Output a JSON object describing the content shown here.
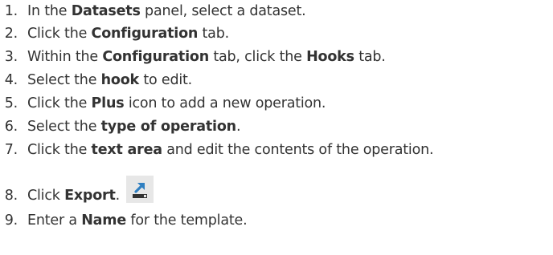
{
  "steps": [
    {
      "num": "1.",
      "parts": [
        {
          "text": "In the ",
          "bold": false
        },
        {
          "text": "Datasets",
          "bold": true
        },
        {
          "text": " panel, select a dataset.",
          "bold": false
        }
      ]
    },
    {
      "num": "2.",
      "parts": [
        {
          "text": "Click the ",
          "bold": false
        },
        {
          "text": "Configuration",
          "bold": true
        },
        {
          "text": " tab.",
          "bold": false
        }
      ]
    },
    {
      "num": "3.",
      "parts": [
        {
          "text": "Within the ",
          "bold": false
        },
        {
          "text": "Configuration",
          "bold": true
        },
        {
          "text": " tab, click the ",
          "bold": false
        },
        {
          "text": "Hooks",
          "bold": true
        },
        {
          "text": " tab.",
          "bold": false
        }
      ]
    },
    {
      "num": "4.",
      "parts": [
        {
          "text": "Select the ",
          "bold": false
        },
        {
          "text": "hook",
          "bold": true
        },
        {
          "text": " to edit.",
          "bold": false
        }
      ]
    },
    {
      "num": "5.",
      "parts": [
        {
          "text": "Click the ",
          "bold": false
        },
        {
          "text": "Plus",
          "bold": true
        },
        {
          "text": " icon to add a new operation.",
          "bold": false
        }
      ]
    },
    {
      "num": "6.",
      "parts": [
        {
          "text": "Select the ",
          "bold": false
        },
        {
          "text": "type of operation",
          "bold": true
        },
        {
          "text": ".",
          "bold": false
        }
      ]
    },
    {
      "num": "7.",
      "parts": [
        {
          "text": "Click the ",
          "bold": false
        },
        {
          "text": "text area",
          "bold": true
        },
        {
          "text": " and edit the contents of the operation.",
          "bold": false
        }
      ]
    },
    {
      "num": "8.",
      "parts": [
        {
          "text": "Click ",
          "bold": false
        },
        {
          "text": "Export",
          "bold": true
        },
        {
          "text": ".",
          "bold": false
        }
      ],
      "icon": "export-icon"
    },
    {
      "num": "9.",
      "parts": [
        {
          "text": "Enter a ",
          "bold": false
        },
        {
          "text": "Name",
          "bold": true
        },
        {
          "text": " for the template.",
          "bold": false
        }
      ]
    }
  ],
  "colors": {
    "text": "#333333",
    "icon_bg": "#e7e7e7",
    "icon_arrow": "#2f7fc1",
    "icon_tray": "#333333"
  }
}
